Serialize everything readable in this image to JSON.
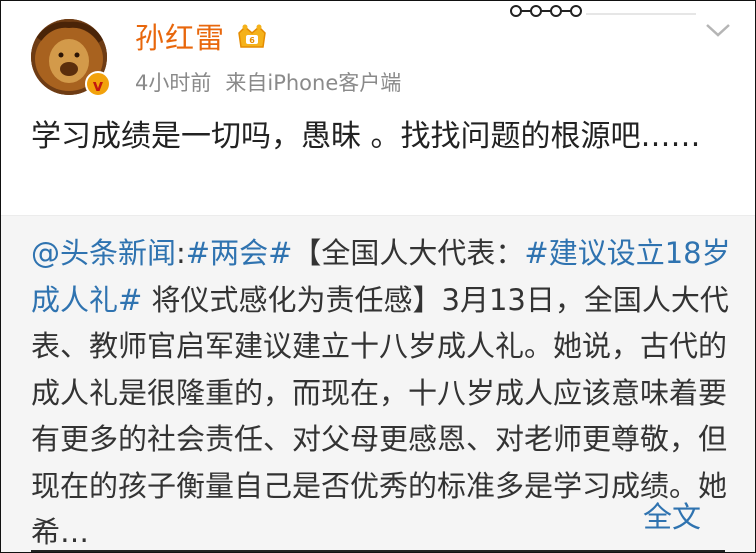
{
  "user": {
    "name": "孙红雷",
    "time": "4小时前",
    "source": "来自iPhone客户端"
  },
  "post": {
    "text": "学习成绩是一切吗，愚昧 。找找问题的根源吧……"
  },
  "repost": {
    "author": "@头条新闻",
    "colon": ":",
    "hashtag1": "#两会#",
    "bracket_open": "【全国人大代表：",
    "hashtag2": "#建议设立18岁成人礼#",
    "after_hashtag": " 将仪式感化为责任感】3月13日，全国人大代表、教师官启军建议建立十八岁成人礼。她说，古代的成人礼是很隆重的，而现在，十八岁成人应该意味着要有更多的社会责任、对父母更感恩、对老师更尊敬，但现在的孩子衡量自己是否优秀的标准多是学习成绩。她希…",
    "more_label": "全文"
  },
  "colors": {
    "name": "#e8670c",
    "link": "#2f73b0",
    "verified": "#f2a20c"
  },
  "icons": {
    "verified": "verified-v-icon",
    "vip": "vip-crown-icon",
    "menu": "chevron-down-icon"
  }
}
